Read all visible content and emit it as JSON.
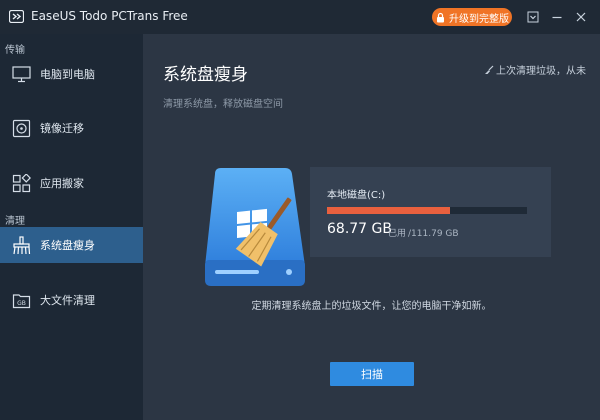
{
  "app": {
    "title": "EaseUS Todo PCTrans Free",
    "upgrade_label": "升级到完整版"
  },
  "sidebar": {
    "section_transfer": "传输",
    "section_clean": "清理",
    "items": [
      {
        "label": "电脑到电脑",
        "icon": "monitor-icon"
      },
      {
        "label": "镜像迁移",
        "icon": "disk-image-icon"
      },
      {
        "label": "应用搬家",
        "icon": "apps-icon"
      },
      {
        "label": "系统盘瘦身",
        "icon": "broom-icon",
        "active": true
      },
      {
        "label": "大文件清理",
        "icon": "gb-folder-icon"
      }
    ]
  },
  "main": {
    "title": "系统盘瘦身",
    "subtitle": "清理系统盘，释放磁盘空间",
    "last_clean": "上次清理垃圾，从未",
    "disk": {
      "name": "本地磁盘(C:)",
      "used": "68.77 GB",
      "used_label": "已用",
      "total": "/111.79 GB",
      "usage_fraction": 0.615
    },
    "description": "定期清理系统盘上的垃圾文件，让您的电脑干净如新。",
    "scan_label": "扫描"
  },
  "colors": {
    "accent_blue": "#2f8be0",
    "upgrade_orange": "#f07426",
    "usage_bar": "#e9603e",
    "active_nav": "#2d5f8d"
  }
}
